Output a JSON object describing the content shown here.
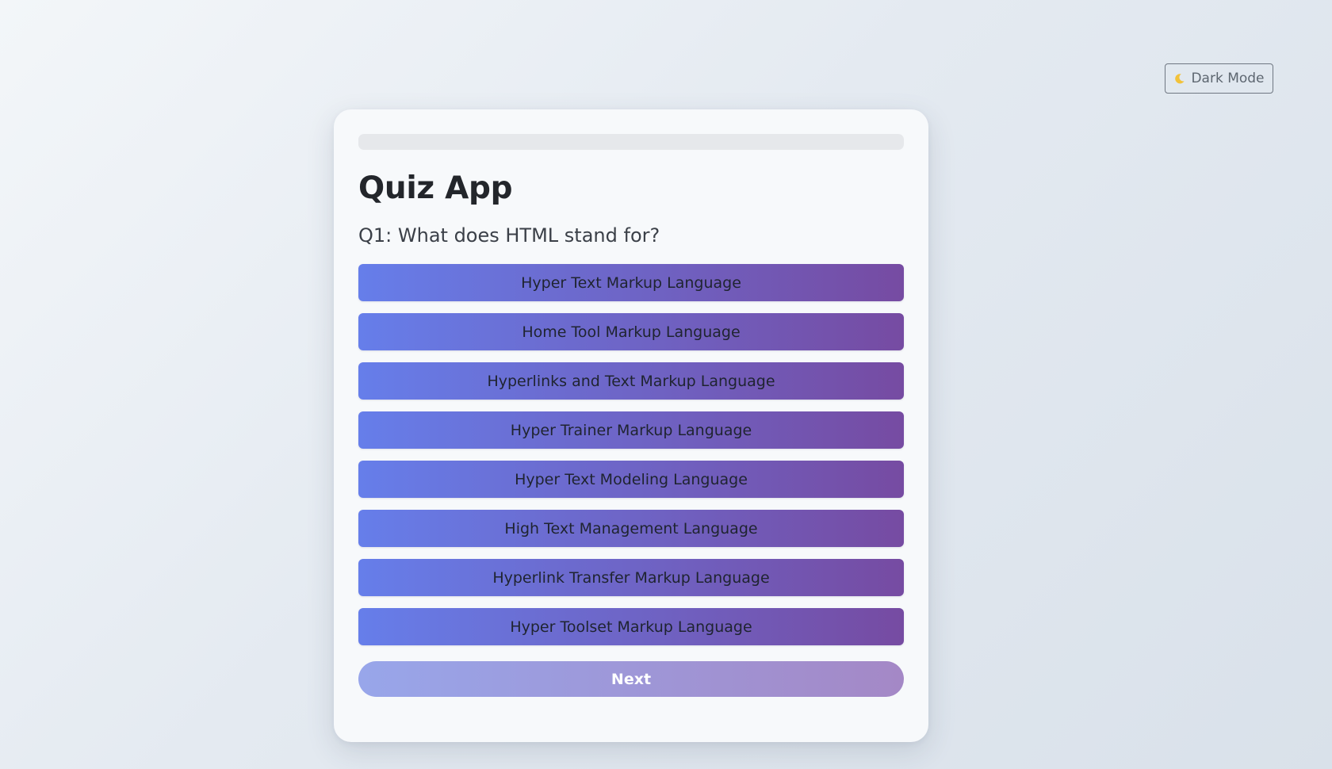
{
  "header": {
    "dark_mode_label": "Dark Mode",
    "dark_mode_icon": "moon-icon"
  },
  "quiz": {
    "title": "Quiz App",
    "progress_fraction": 0,
    "question": "Q1: What does HTML stand for?",
    "options": [
      "Hyper Text Markup Language",
      "Home Tool Markup Language",
      "Hyperlinks and Text Markup Language",
      "Hyper Trainer Markup Language",
      "Hyper Text Modeling Language",
      "High Text Management Language",
      "Hyperlink Transfer Markup Language",
      "Hyper Toolset Markup Language"
    ],
    "next_label": "Next"
  },
  "colors": {
    "option_gradient_start": "#667eea",
    "option_gradient_end": "#764ba2",
    "next_gradient_start": "#98a6ea",
    "next_gradient_end": "#a488c6",
    "moon": "#f2c23a"
  }
}
